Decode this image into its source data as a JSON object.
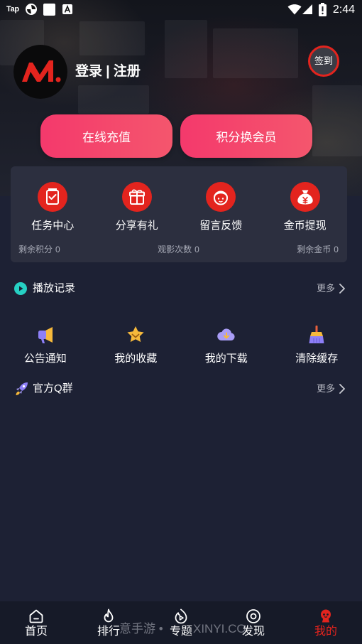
{
  "status_bar": {
    "app_label": "Tap",
    "time": "2:44"
  },
  "profile": {
    "login_label": "登录 | 注册",
    "checkin_label": "签到"
  },
  "actions": [
    {
      "label": "在线充值"
    },
    {
      "label": "积分换会员"
    }
  ],
  "card": {
    "items": [
      {
        "label": "任务中心",
        "icon": "task-icon"
      },
      {
        "label": "分享有礼",
        "icon": "gift-icon"
      },
      {
        "label": "留言反馈",
        "icon": "feedback-icon"
      },
      {
        "label": "金币提现",
        "icon": "money-bag-icon"
      }
    ],
    "stats": [
      {
        "label": "剩余积分",
        "value": "0"
      },
      {
        "label": "观影次数",
        "value": "0"
      },
      {
        "label": "剩余金币",
        "value": "0"
      }
    ]
  },
  "history": {
    "title": "播放记录",
    "more": "更多",
    "icon": "play-circle-icon"
  },
  "tools": [
    {
      "label": "公告通知",
      "icon": "megaphone-icon"
    },
    {
      "label": "我的收藏",
      "icon": "star-icon"
    },
    {
      "label": "我的下载",
      "icon": "cloud-download-icon"
    },
    {
      "label": "清除缓存",
      "icon": "broom-icon"
    }
  ],
  "qq_group": {
    "title": "官方Q群",
    "more": "更多",
    "icon": "rocket-icon"
  },
  "tabbar": {
    "items": [
      {
        "label": "首页",
        "icon": "home-icon"
      },
      {
        "label": "排行",
        "icon": "fire-icon"
      },
      {
        "label": "专题",
        "icon": "topic-icon"
      },
      {
        "label": "发现",
        "icon": "discover-icon"
      },
      {
        "label": "我的",
        "icon": "mascot-icon",
        "active": true
      }
    ]
  },
  "watermark": {
    "part1": "意手游 •",
    "part2": "XINYI.CO"
  },
  "colors": {
    "accent": "#e3241e",
    "button_start": "#f4396c",
    "button_end": "#f4566d",
    "teal": "#26d0c3",
    "background": "#1d2134",
    "card": "#2c2f3f"
  }
}
